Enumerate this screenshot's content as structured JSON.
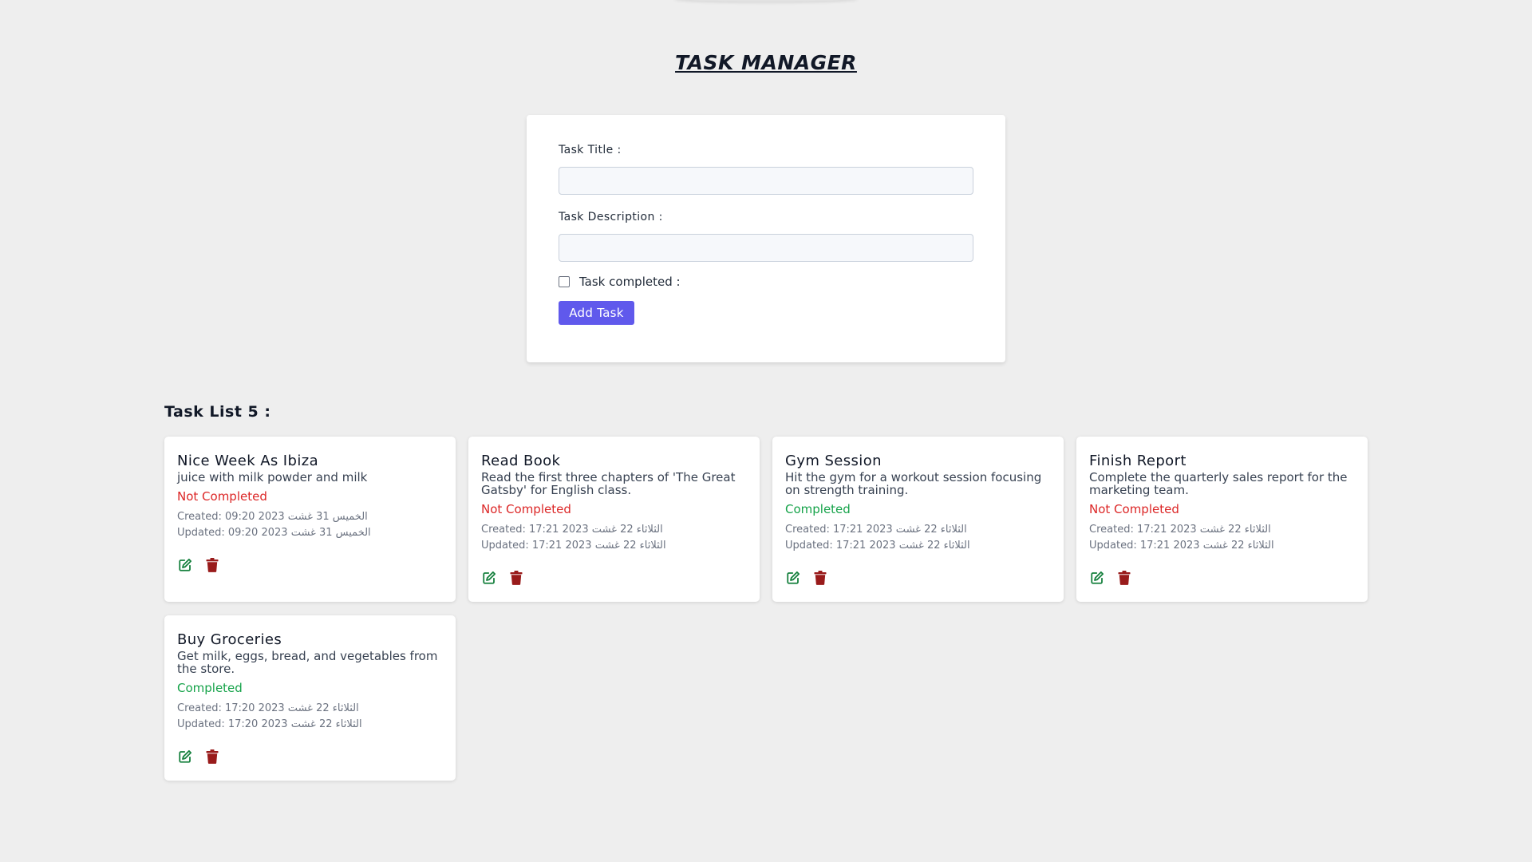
{
  "app": {
    "title": "TASK MANAGER"
  },
  "form": {
    "title_label": "Task Title :",
    "title_value": "",
    "description_label": "Task Description :",
    "description_value": "",
    "completed_label": "Task completed :",
    "completed_checked": false,
    "add_button": "Add Task"
  },
  "list": {
    "heading": "Task List 5 :"
  },
  "colors": {
    "accent": "#6059ec",
    "not_completed": "#dc2626",
    "completed": "#16a34a",
    "edit_icon": "#15803d",
    "delete_icon": "#991b1b"
  },
  "tasks": [
    {
      "title": "Nice Week As Ibiza",
      "description": "juice with milk powder and milk",
      "status": "Not Completed",
      "completed": false,
      "created": "Created: الخميس 31 غشت 2023 09:20",
      "updated": "Updated: الخميس 31 غشت 2023 09:20",
      "edit_icon": "edit-icon",
      "delete_icon": "trash-icon"
    },
    {
      "title": "Read Book",
      "description": "Read the first three chapters of 'The Great Gatsby' for English class.",
      "status": "Not Completed",
      "completed": false,
      "created": "Created: الثلاثاء 22 غشت 2023 17:21",
      "updated": "Updated: الثلاثاء 22 غشت 2023 17:21",
      "edit_icon": "edit-icon",
      "delete_icon": "trash-icon"
    },
    {
      "title": "Gym Session",
      "description": "Hit the gym for a workout session focusing on strength training.",
      "status": "Completed",
      "completed": true,
      "created": "Created: الثلاثاء 22 غشت 2023 17:21",
      "updated": "Updated: الثلاثاء 22 غشت 2023 17:21",
      "edit_icon": "edit-icon",
      "delete_icon": "trash-icon"
    },
    {
      "title": "Finish Report",
      "description": "Complete the quarterly sales report for the marketing team.",
      "status": "Not Completed",
      "completed": false,
      "created": "Created: الثلاثاء 22 غشت 2023 17:21",
      "updated": "Updated: الثلاثاء 22 غشت 2023 17:21",
      "edit_icon": "edit-icon",
      "delete_icon": "trash-icon"
    },
    {
      "title": "Buy Groceries",
      "description": "Get milk, eggs, bread, and vegetables from the store.",
      "status": "Completed",
      "completed": true,
      "created": "Created: الثلاثاء 22 غشت 2023 17:20",
      "updated": "Updated: الثلاثاء 22 غشت 2023 17:20",
      "edit_icon": "edit-icon",
      "delete_icon": "trash-icon"
    }
  ]
}
